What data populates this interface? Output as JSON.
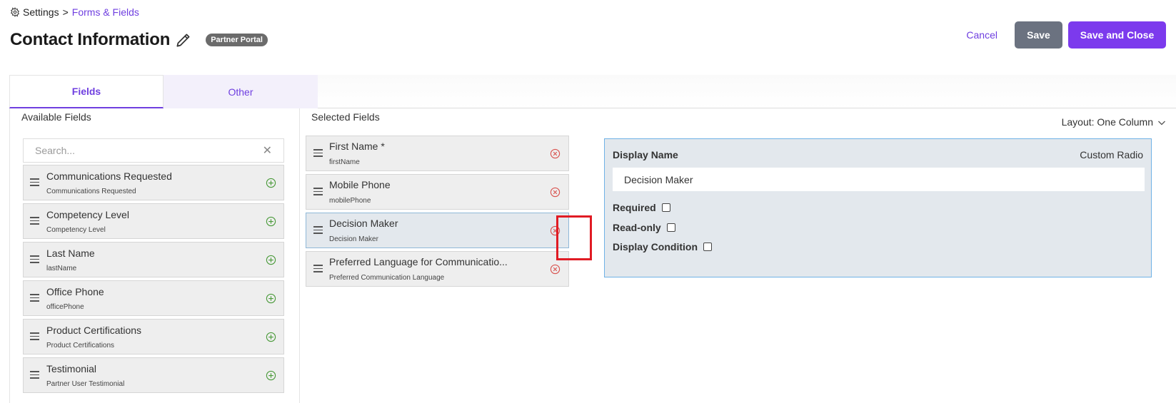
{
  "breadcrumb": {
    "root": "Settings",
    "separator": ">",
    "current": "Forms & Fields"
  },
  "header": {
    "title": "Contact Information",
    "badge": "Partner Portal"
  },
  "actions": {
    "cancel": "Cancel",
    "save": "Save",
    "save_close": "Save and Close"
  },
  "tabs": [
    {
      "label": "Fields",
      "active": true
    },
    {
      "label": "Other",
      "active": false
    }
  ],
  "available": {
    "label": "Available Fields",
    "search_placeholder": "Search...",
    "items": [
      {
        "name": "Communications Requested",
        "sub": "Communications Requested"
      },
      {
        "name": "Competency Level",
        "sub": "Competency Level"
      },
      {
        "name": "Last Name",
        "sub": "lastName"
      },
      {
        "name": "Office Phone",
        "sub": "officePhone"
      },
      {
        "name": "Product Certifications",
        "sub": "Product Certifications"
      },
      {
        "name": "Testimonial",
        "sub": "Partner User Testimonial"
      }
    ]
  },
  "selected": {
    "label": "Selected Fields",
    "layout": "Layout: One Column",
    "items": [
      {
        "name": "First Name *",
        "sub": "firstName"
      },
      {
        "name": "Mobile Phone",
        "sub": "mobilePhone"
      },
      {
        "name": "Decision Maker",
        "sub": "Decision Maker",
        "selected": true
      },
      {
        "name": "Preferred Language for Communicatio...",
        "sub": "Preferred Communication Language"
      }
    ]
  },
  "properties": {
    "display_name_label": "Display Name",
    "field_type": "Custom Radio",
    "display_name_value": "Decision Maker",
    "required_label": "Required",
    "readonly_label": "Read-only",
    "display_condition_label": "Display Condition"
  },
  "colors": {
    "accent": "#7c3aed",
    "link": "#6f3fe0",
    "remove": "#d9534f",
    "add": "#4a9a3a",
    "highlight": "#e01b24"
  }
}
